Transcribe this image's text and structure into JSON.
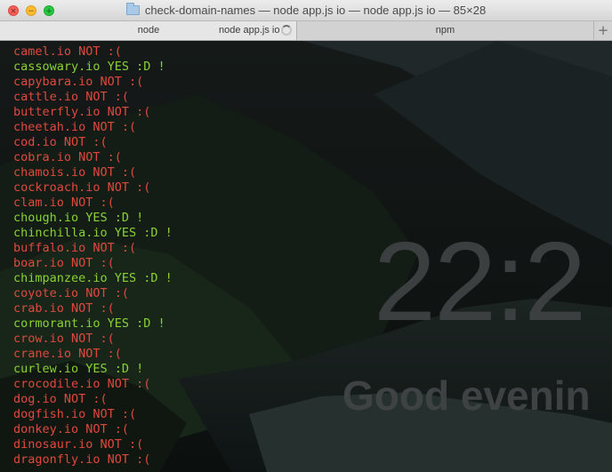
{
  "window": {
    "title": "check-domain-names — node app.js io — node app.js io — 85×28",
    "controls": {
      "close": "×",
      "minimize": "−",
      "zoom": "+"
    }
  },
  "tabs": [
    {
      "label": "node",
      "active": true
    },
    {
      "label": "node app.js io",
      "active": true,
      "busy": true
    },
    {
      "label": "npm",
      "active": false
    }
  ],
  "new_tab_label": "+",
  "background": {
    "clock": "22:2",
    "greeting": "Good evenin"
  },
  "output_colors": {
    "available": "#8ad233",
    "taken": "#e0483e"
  },
  "terminal_lines": [
    {
      "text": "camel.io NOT :(",
      "available": false
    },
    {
      "text": "cassowary.io YES :D !",
      "available": true
    },
    {
      "text": "capybara.io NOT :(",
      "available": false
    },
    {
      "text": "cattle.io NOT :(",
      "available": false
    },
    {
      "text": "butterfly.io NOT :(",
      "available": false
    },
    {
      "text": "cheetah.io NOT :(",
      "available": false
    },
    {
      "text": "cod.io NOT :(",
      "available": false
    },
    {
      "text": "cobra.io NOT :(",
      "available": false
    },
    {
      "text": "chamois.io NOT :(",
      "available": false
    },
    {
      "text": "cockroach.io NOT :(",
      "available": false
    },
    {
      "text": "clam.io NOT :(",
      "available": false
    },
    {
      "text": "chough.io YES :D !",
      "available": true
    },
    {
      "text": "chinchilla.io YES :D !",
      "available": true
    },
    {
      "text": "buffalo.io NOT :(",
      "available": false
    },
    {
      "text": "boar.io NOT :(",
      "available": false
    },
    {
      "text": "chimpanzee.io YES :D !",
      "available": true
    },
    {
      "text": "coyote.io NOT :(",
      "available": false
    },
    {
      "text": "crab.io NOT :(",
      "available": false
    },
    {
      "text": "cormorant.io YES :D !",
      "available": true
    },
    {
      "text": "crow.io NOT :(",
      "available": false
    },
    {
      "text": "crane.io NOT :(",
      "available": false
    },
    {
      "text": "curlew.io YES :D !",
      "available": true
    },
    {
      "text": "crocodile.io NOT :(",
      "available": false
    },
    {
      "text": "dog.io NOT :(",
      "available": false
    },
    {
      "text": "dogfish.io NOT :(",
      "available": false
    },
    {
      "text": "donkey.io NOT :(",
      "available": false
    },
    {
      "text": "dinosaur.io NOT :(",
      "available": false
    },
    {
      "text": "dragonfly.io NOT :(",
      "available": false
    }
  ]
}
